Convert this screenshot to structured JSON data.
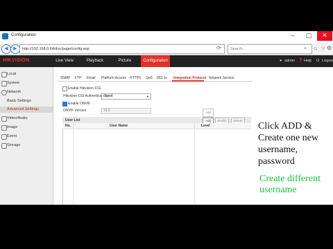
{
  "browser": {
    "tab_title": "Configuration",
    "url": "http://192.168.0.64/doc/page/config.asp",
    "search_placeholder": "Search...",
    "back_glyph": "◀",
    "forward_glyph": "▶"
  },
  "app": {
    "logo": "HIKVISION",
    "nav": [
      "Live View",
      "Playback",
      "Picture",
      "Configuration"
    ],
    "user": "admin",
    "help": "Help",
    "logout": "Logout"
  },
  "sidebar": {
    "items": [
      "Local",
      "System",
      "Network",
      "Basic Settings",
      "Advanced Settings",
      "Video/Audio",
      "Image",
      "Event",
      "Storage"
    ]
  },
  "tabs": [
    "SNMP",
    "FTP",
    "Email",
    "Platform Access",
    "HTTPS",
    "QoS",
    "802.1x",
    "Integration Protocol",
    "Network Service"
  ],
  "form": {
    "enable_hikvision_cgi": "Enable Hikvision-CGI",
    "cgi_auth_label": "Hikvision-CGI Authenticat",
    "cgi_auth_value": "digest",
    "enable_onvif": "Enable ONVIF",
    "onvif_version_label": "ONVIF Version",
    "onvif_version_value": "16.6"
  },
  "user_list": {
    "title": "User List",
    "buttons": {
      "add": "Add",
      "modify": "Modify",
      "delete": "Delete",
      "tooltip": "Add"
    },
    "columns": [
      "No.",
      "User Name",
      "Level"
    ]
  },
  "annotations": {
    "black": [
      "Click ADD &",
      "Create one new",
      "username,",
      "password"
    ],
    "green": [
      "Create different",
      "username"
    ]
  },
  "colors": {
    "accent": "#e0322a",
    "annotation_green": "#20c040"
  }
}
